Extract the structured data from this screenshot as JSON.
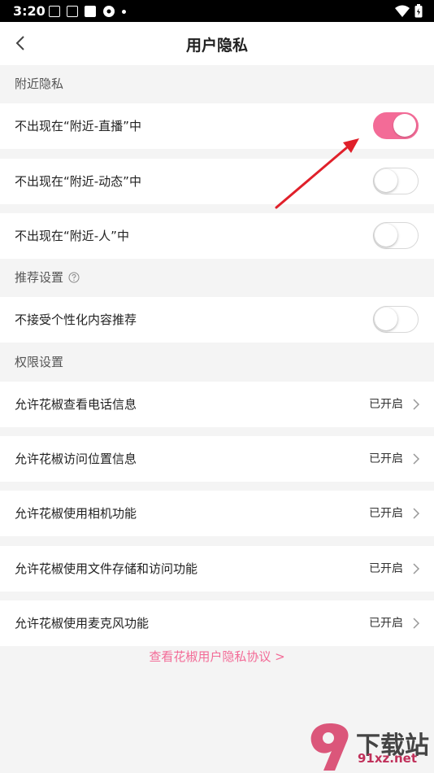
{
  "status_bar": {
    "time": "3:20"
  },
  "header": {
    "title": "用户隐私"
  },
  "sections": {
    "nearby": {
      "title": "附近隐私",
      "items": [
        {
          "label": "不出现在“附近-直播”中",
          "enabled": true
        },
        {
          "label": "不出现在“附近-动态”中",
          "enabled": false
        },
        {
          "label": "不出现在“附近-人”中",
          "enabled": false
        }
      ]
    },
    "recommend": {
      "title": "推荐设置",
      "items": [
        {
          "label": "不接受个性化内容推荐",
          "enabled": false
        }
      ]
    },
    "permissions": {
      "title": "权限设置",
      "items": [
        {
          "label": "允许花椒查看电话信息",
          "status": "已开启"
        },
        {
          "label": "允许花椒访问位置信息",
          "status": "已开启"
        },
        {
          "label": "允许花椒使用相机功能",
          "status": "已开启"
        },
        {
          "label": "允许花椒使用文件存储和访问功能",
          "status": "已开启"
        },
        {
          "label": "允许花椒使用麦克风功能",
          "status": "已开启"
        }
      ]
    }
  },
  "policy_link": "查看花椒用户隐私协议 >",
  "watermark": {
    "logo_text": "下载站",
    "url": "91xz.net"
  },
  "colors": {
    "accent": "#f36b97",
    "background": "#f4f4f4",
    "annotation_arrow": "#e0202a"
  }
}
